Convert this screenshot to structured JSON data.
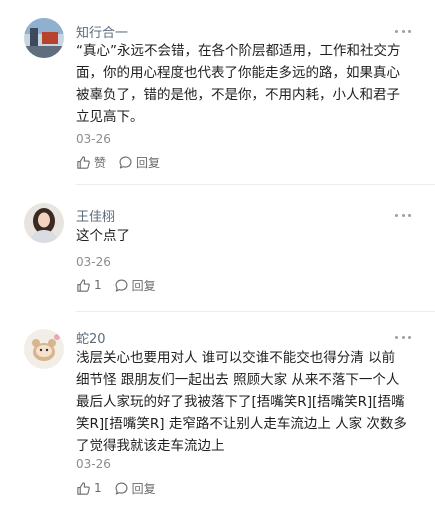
{
  "comments": [
    {
      "username": "知行合一",
      "content_lines": [
        "“真心”永远不会错，在各个阶层都适用，工作和社交方",
        "面，你的用心程度也代表了你能走多远的路，如果真心",
        "被辜负了，错的是他，不是你，不用内耗，小人和君子",
        "立见高下。"
      ],
      "date": "03-26",
      "like_label": "赞",
      "reply_label": "回复"
    },
    {
      "username": "王佳栩",
      "content_lines": [
        "这个点了"
      ],
      "date": "03-26",
      "like_label": "1",
      "reply_label": "回复"
    },
    {
      "username": "蛇20",
      "content_lines": [
        "浅层关心也要用对人 谁可以交谁不能交也得分清 以前",
        "细节怪 跟朋友们一起出去 照顾大家 从来不落下一个人",
        "最后人家玩的好了我被落下了[捂嘴笑R][捂嘴笑R][捂嘴",
        "笑R][捂嘴笑R] 走窄路不让别人走车流边上 人家 次数多",
        "了觉得我就该走车流边上"
      ],
      "date": "03-26",
      "like_label": "1",
      "reply_label": "回复"
    }
  ],
  "icons": {
    "more": "more-dots-icon",
    "like": "thumbs-up-icon",
    "reply": "comment-bubble-icon"
  },
  "colors": {
    "username": "#5b6b7a",
    "text": "#1f1f1f",
    "meta": "#8c8c8c",
    "divider": "#ececec"
  }
}
